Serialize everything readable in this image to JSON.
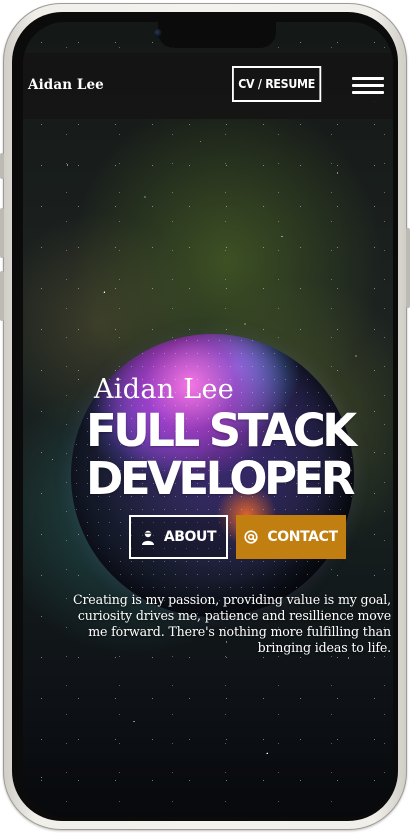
{
  "nav": {
    "brand": "Aidan Lee",
    "cv_label": "CV / RESUME",
    "menu_icon": "hamburger-menu-icon"
  },
  "hero": {
    "name": "Aidan Lee",
    "title_line1": "FULL STACK",
    "title_line2": "DEVELOPER",
    "about_label": "ABOUT",
    "about_icon": "user-icon",
    "contact_label": "CONTACT",
    "contact_icon": "at-sign-icon",
    "bio": "Creating is my passion, providing value is my goal, curiosity drives me, patience and resillience move me forward. There's nothing more fulfilling than bringing ideas to life."
  },
  "colors": {
    "navbar_bg": "#141414",
    "accent": "#c07f10",
    "text": "#ffffff"
  }
}
